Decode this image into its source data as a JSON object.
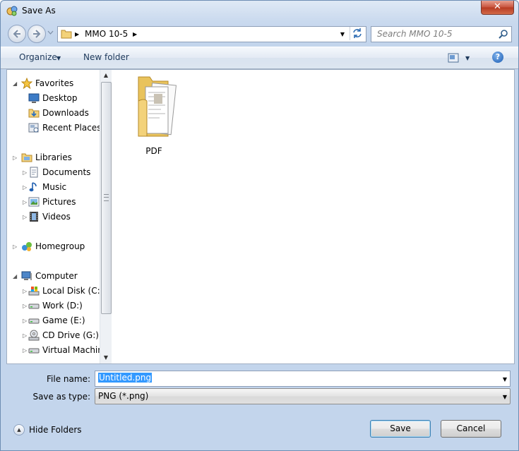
{
  "window": {
    "title": "Save As"
  },
  "address": {
    "crumb": "MMO 10-5"
  },
  "search": {
    "placeholder": "Search MMO 10-5"
  },
  "toolbar": {
    "organize_label": "Organize",
    "new_folder_label": "New folder"
  },
  "navpane": {
    "items": [
      {
        "label": "Favorites",
        "icon": "star-icon"
      },
      {
        "label": "Desktop",
        "icon": "desktop-icon"
      },
      {
        "label": "Downloads",
        "icon": "downloads-icon"
      },
      {
        "label": "Recent Places",
        "icon": "recent-places-icon"
      },
      {
        "label": "Libraries",
        "icon": "libraries-icon"
      },
      {
        "label": "Documents",
        "icon": "documents-icon"
      },
      {
        "label": "Music",
        "icon": "music-icon"
      },
      {
        "label": "Pictures",
        "icon": "pictures-icon"
      },
      {
        "label": "Videos",
        "icon": "videos-icon"
      },
      {
        "label": "Homegroup",
        "icon": "homegroup-icon"
      },
      {
        "label": "Computer",
        "icon": "computer-icon"
      },
      {
        "label": "Local Disk (C:)",
        "icon": "local-disk-icon"
      },
      {
        "label": "Work (D:)",
        "icon": "drive-icon"
      },
      {
        "label": "Game (E:)",
        "icon": "drive-icon"
      },
      {
        "label": "CD Drive (G:)",
        "icon": "cd-drive-icon"
      },
      {
        "label": "Virtual Machine",
        "icon": "drive-icon"
      }
    ]
  },
  "files": [
    {
      "name": "PDF",
      "icon": "folder-icon"
    }
  ],
  "bottom": {
    "file_name_label": "File name:",
    "file_name_value": "Untitled.png",
    "save_type_label": "Save as type:",
    "save_type_value": "PNG (*.png)",
    "hide_folders_label": "Hide Folders",
    "save_label": "Save",
    "cancel_label": "Cancel"
  }
}
